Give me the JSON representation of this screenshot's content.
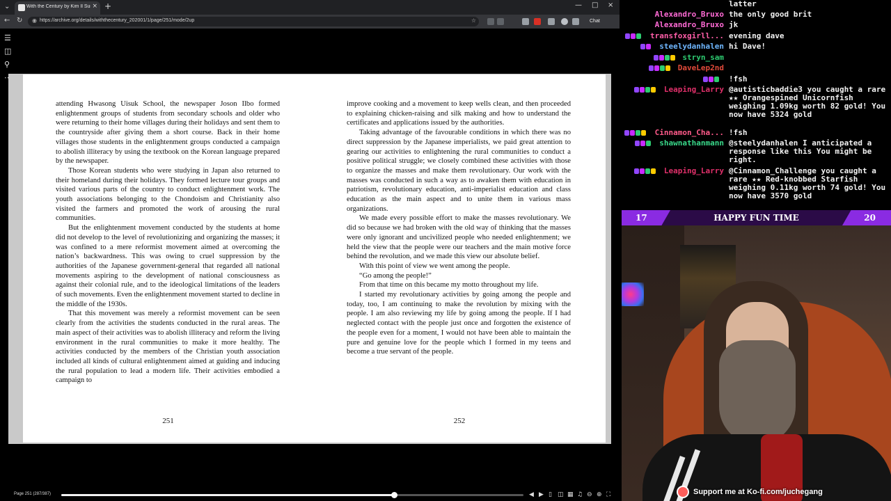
{
  "browser": {
    "tab": {
      "title": "With the Century by Kim Il Sung (..."
    },
    "url": "https://archive.org/details/withthecentury_202001/1/page/251/mode/2up",
    "chat_label": "Chat"
  },
  "reader": {
    "left_page": {
      "number": "251",
      "paragraphs": [
        "attending Hwasong Uisuk School, the newspaper Joson Ilbo formed enlightenment groups of students from secondary schools and older who were returning to their home villages during their holidays and sent them to the countryside after giving them a short course. Back in their home villages those students in the enlightenment groups conducted a campaign to abolish illiteracy by using the textbook on the Korean language prepared by the newspaper.",
        "Those Korean students who were studying in Japan also returned to their homeland during their holidays. They formed lecture tour groups and visited various parts of the country to conduct enlightenment work. The youth associations belonging to the Chondoism and Christianity also visited the farmers and promoted the work of arousing the rural communities.",
        "But the enlightenment movement conducted by the students at home did not develop to the level of revolutionizing and organizing the masses; it was confined to a mere reformist movement aimed at overcoming the nation’s backwardness. This was owing to cruel suppression by the authorities of the Japanese government-general that regarded all national movements aspiring to the development of national consciousness as against their colonial rule, and to the ideological limitations of the leaders of such movements. Even the enlightenment movement started to decline in the middle of the 1930s.",
        "That this movement was merely a reformist movement can be seen clearly from the activities the students conducted in the rural areas. The main aspect of their activities was to abolish illiteracy and reform the living environment in the rural communities to make it more healthy. The activities conducted by the members of the Christian youth association included all kinds of cultural enlightenment aimed at guiding and inducing the rural population to lead a modern life. Their activities embodied a campaign to"
      ]
    },
    "right_page": {
      "number": "252",
      "paragraphs": [
        "improve cooking and a movement to keep wells clean, and then proceeded to explaining chicken-raising and silk making and how to understand the certificates and applications issued by the authorities.",
        "Taking advantage of the favourable conditions in which there was no direct suppression by the Japanese imperialists, we paid great attention to gearing our activities to enlightening the rural communities to conduct a positive political struggle; we closely combined these activities with those to organize the masses and make them revolutionary. Our work with the masses was conducted in such a way as to awaken them with education in patriotism, revolutionary education, anti-imperialist education and class education as the main aspect and to unite them in various mass organizations.",
        "We made every possible effort to make the masses revolutionary. We did so because we had broken with the old way of thinking that the masses were only ignorant and uncivilized people who needed enlightenment; we held the view that the people were our teachers and the main motive force behind the revolution, and we made this view our absolute belief.",
        "With this point of view we went among the people.",
        "“Go among the people!”",
        "From that time on this became my motto throughout my life.",
        "I started my revolutionary activities by going among the people and today, too, I am continuing to make the revolution by mixing with the people. I am also reviewing my life by going among the people. If I had neglected contact with the people just once and forgotten the existence of the people even for a moment, I would not have been able to maintain the pure and genuine love for the people which I formed in my teens and become a true servant of the people."
      ]
    },
    "page_indicator": "Page 251 (287/387)",
    "progress_fraction": 0.72
  },
  "chat": [
    {
      "user": "",
      "message": "latter",
      "color": "#ffffff"
    },
    {
      "user": "Alexandro_Bruxo",
      "message": "the only good brit",
      "color": "#ff6ad5"
    },
    {
      "user": "Alexandro_Bruxo",
      "message": "jk",
      "color": "#ff6ad5"
    },
    {
      "user": "transfoxgirll...",
      "message": "evening dave",
      "color": "#ff5ea8"
    },
    {
      "user": "steelydanhalen",
      "message": "hi Dave!",
      "color": "#6fb7ff"
    },
    {
      "user": "stryn_sam",
      "message": "",
      "color": "#2ecc71"
    },
    {
      "user": "DaveLep2nd",
      "message": "",
      "color": "#e04a3a"
    },
    {
      "user": "",
      "message": "!fsh",
      "color": "#3a5fff"
    },
    {
      "user": "Leaping_Larry",
      "message": "@autisticbaddie3 you caught a rare ★★ Orangespined Unicornfish weighing 1.09kg worth 82 gold! You now have 5324 gold",
      "color": "#e0306a"
    },
    {
      "user": "Cinnamon_Cha...",
      "message": "!fsh",
      "color": "#ff5a8a"
    },
    {
      "user": "shawnathanmann",
      "message": "@steelydanhalen I anticipated a response like this You might be right.",
      "color": "#39d98a"
    },
    {
      "user": "Leaping_Larry",
      "message": "@Cinnamon_Challenge you caught a rare ★★ Red-knobbed Starfish weighing 0.11kg worth 74 gold! You now have 3570 gold",
      "color": "#e0306a"
    }
  ],
  "banner": {
    "left_num": "17",
    "title": "HAPPY FUN TIME",
    "right_num": "20"
  },
  "kofi_text": "Support me at Ko-fi.com/juchegang"
}
